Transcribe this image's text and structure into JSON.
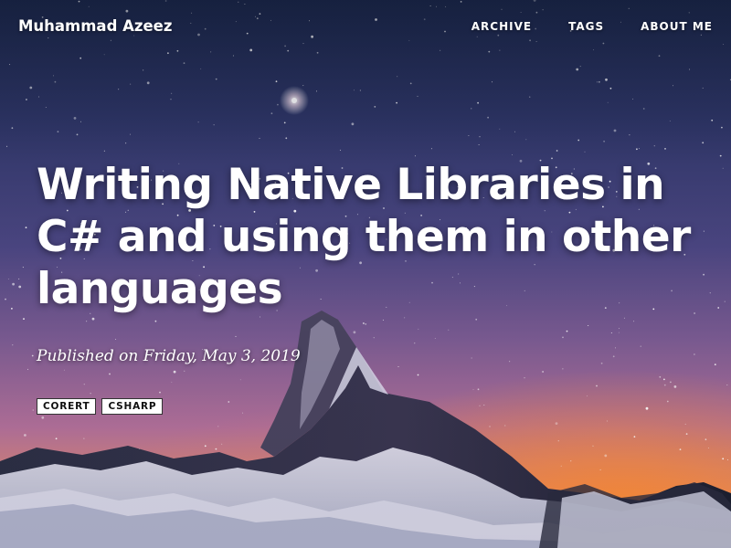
{
  "site": {
    "brand": "Muhammad Azeez"
  },
  "nav": {
    "items": [
      {
        "label": "ARCHIVE"
      },
      {
        "label": "TAGS"
      },
      {
        "label": "ABOUT ME"
      }
    ]
  },
  "post": {
    "title": "Writing Native Libraries in C# and using them in other languages",
    "published": "Published on Friday, May 3, 2019",
    "tags": [
      {
        "label": "CORERT"
      },
      {
        "label": "CSHARP"
      }
    ]
  },
  "background": {
    "scene": "starry-night-mountain-icon",
    "colors": {
      "sky_top": "#1d2a4e",
      "sky_mid": "#4a4580",
      "horizon_glow": "#f49a55"
    }
  }
}
